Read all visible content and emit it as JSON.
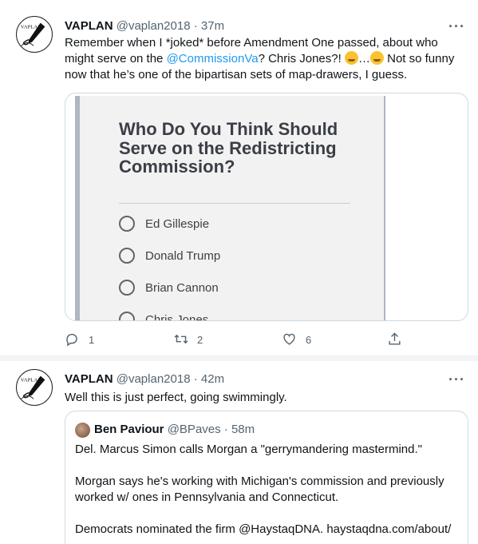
{
  "tweet1": {
    "name": "VAPLAN",
    "handle": "@vaplan2018",
    "time": "· 37m",
    "text_before": "Remember when I *joked* before Amendment One passed, about who might serve on the ",
    "mention": "@CommissionVa",
    "text_middle": "? Chris Jones?! ",
    "ellipsis": "…",
    "text_after": " Not so funny now that he’s one of the bipartisan sets of map-drawers, I guess.",
    "emojis": [
      "face-with-tears-of-joy",
      "relieved-face"
    ],
    "image": {
      "title": "Who Do You Think Should Serve on the Redistricting Commission?",
      "options": [
        "Ed Gillespie",
        "Donald Trump",
        "Brian Cannon",
        "Chris Jones"
      ]
    },
    "actions": {
      "replies": "1",
      "retweets": "2",
      "likes": "6"
    }
  },
  "tweet2": {
    "name": "VAPLAN",
    "handle": "@vaplan2018",
    "time": "· 42m",
    "text": "Well this is just perfect, going swimmingly.",
    "quote": {
      "name": "Ben Paviour",
      "handle": "@BPaves",
      "time": "· 58m",
      "paragraphs": [
        "Del. Marcus Simon calls Morgan a \"gerrymandering mastermind.\"",
        "Morgan says he's working with Michigan's commission and previously worked w/ ones in Pennsylvania and Connecticut.",
        "Democrats nominated the firm @HaystaqDNA.  haystaqdna.com/about/"
      ]
    }
  },
  "more_glyph": "···",
  "icons": [
    "reply-icon",
    "retweet-icon",
    "like-icon",
    "share-icon",
    "more-icon"
  ],
  "colors": {
    "link": "#1d9bf0",
    "muted": "#536471",
    "border": "#cfd9de"
  }
}
